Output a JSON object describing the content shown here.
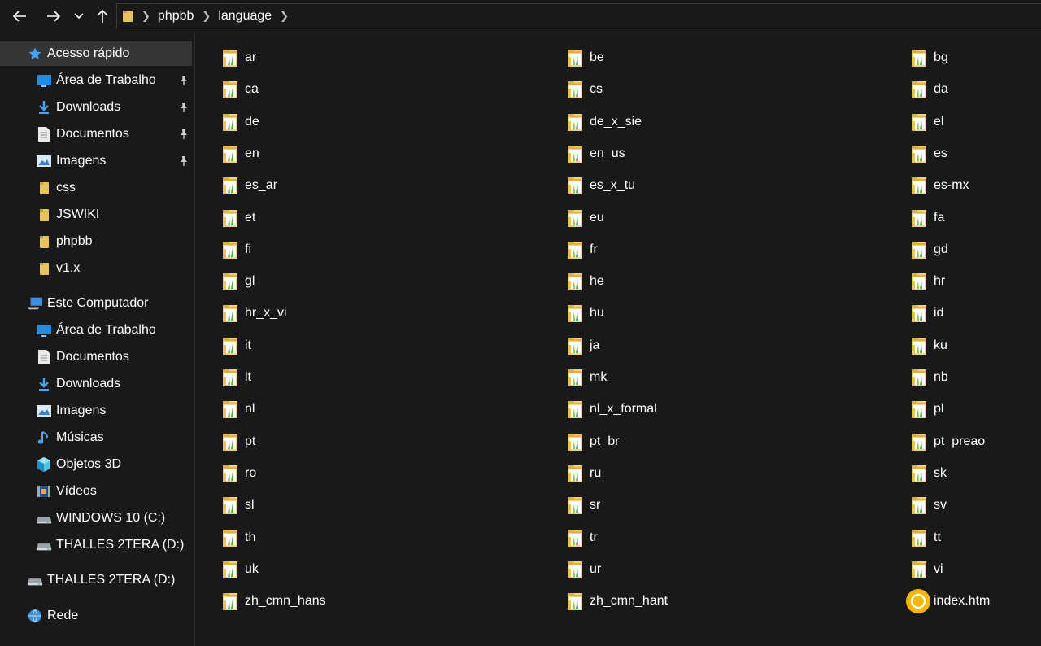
{
  "window": {
    "back_icon": "arrow-left-icon",
    "forward_icon": "arrow-right-icon",
    "recent_icon": "chevron-down-icon",
    "up_icon": "arrow-up-icon"
  },
  "breadcrumb": {
    "items": [
      "phpbb",
      "language"
    ]
  },
  "sidebar": {
    "items": [
      {
        "label": "Acesso rápido",
        "icon": "star-icon",
        "pinned": false
      },
      {
        "label": "Área de Trabalho",
        "icon": "desktop-icon",
        "pinned": true
      },
      {
        "label": "Downloads",
        "icon": "download-icon",
        "pinned": true
      },
      {
        "label": "Documentos",
        "icon": "document-icon",
        "pinned": true
      },
      {
        "label": "Imagens",
        "icon": "image-icon",
        "pinned": true
      },
      {
        "label": "css",
        "icon": "folder-icon",
        "pinned": false
      },
      {
        "label": "JSWIKI",
        "icon": "folder-icon",
        "pinned": false
      },
      {
        "label": "phpbb",
        "icon": "folder-icon",
        "pinned": false
      },
      {
        "label": "v1.x",
        "icon": "folder-icon",
        "pinned": false
      },
      {
        "label": "Este Computador",
        "icon": "computer-icon",
        "pinned": false
      },
      {
        "label": "Área de Trabalho",
        "icon": "desktop-icon",
        "pinned": false
      },
      {
        "label": "Documentos",
        "icon": "document-icon",
        "pinned": false
      },
      {
        "label": "Downloads",
        "icon": "download-icon",
        "pinned": false
      },
      {
        "label": "Imagens",
        "icon": "image-icon",
        "pinned": false
      },
      {
        "label": "Músicas",
        "icon": "music-icon",
        "pinned": false
      },
      {
        "label": "Objetos 3D",
        "icon": "cube-icon",
        "pinned": false
      },
      {
        "label": "Vídeos",
        "icon": "video-icon",
        "pinned": false
      },
      {
        "label": "WINDOWS 10 (C:)",
        "icon": "drive-icon",
        "pinned": false
      },
      {
        "label": "THALLES 2TERA (D:)",
        "icon": "drive-icon",
        "pinned": false
      },
      {
        "label": "THALLES 2TERA (D:)",
        "icon": "drive-icon",
        "pinned": false
      },
      {
        "label": "Rede",
        "icon": "network-icon",
        "pinned": false
      }
    ]
  },
  "files": [
    "ar",
    "be",
    "bg",
    "ca",
    "cs",
    "da",
    "de",
    "de_x_sie",
    "el",
    "en",
    "en_us",
    "es",
    "es_ar",
    "es_x_tu",
    "es-mx",
    "et",
    "eu",
    "fa",
    "fi",
    "fr",
    "gd",
    "gl",
    "he",
    "hr",
    "hr_x_vi",
    "hu",
    "id",
    "it",
    "ja",
    "ku",
    "lt",
    "mk",
    "nb",
    "nl",
    "nl_x_formal",
    "pl",
    "pt",
    "pt_br",
    "pt_preao",
    "ro",
    "ru",
    "sk",
    "sl",
    "sr",
    "sv",
    "th",
    "tr",
    "tt",
    "uk",
    "ur",
    "vi",
    "zh_cmn_hans",
    "zh_cmn_hant",
    "index.htm"
  ],
  "colors": {
    "folder": "#e8c25a",
    "selected": "#353535",
    "accent": "#4aa3f0",
    "html_file": "#f5b800"
  }
}
